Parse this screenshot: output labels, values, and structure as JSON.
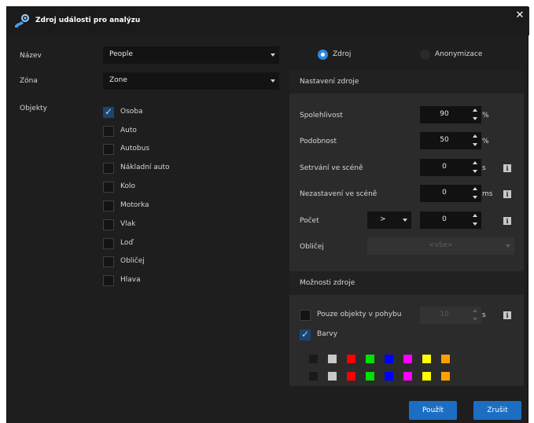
{
  "dialog": {
    "title": "Zdroj události pro analýzu",
    "close_label": "✕",
    "title_icon": "camera-gear-icon"
  },
  "left": {
    "name_label": "Název",
    "name_value": "People",
    "zone_label": "Zóna",
    "zone_value": "Zone",
    "objects_label": "Objekty",
    "objects": [
      {
        "label": "Osoba",
        "checked": true
      },
      {
        "label": "Auto",
        "checked": false
      },
      {
        "label": "Autobus",
        "checked": false
      },
      {
        "label": "Nákladní auto",
        "checked": false
      },
      {
        "label": "Kolo",
        "checked": false
      },
      {
        "label": "Motorka",
        "checked": false
      },
      {
        "label": "Vlak",
        "checked": false
      },
      {
        "label": "Loď",
        "checked": false
      },
      {
        "label": "Obličej",
        "checked": false
      },
      {
        "label": "Hlava",
        "checked": false
      }
    ]
  },
  "mode": {
    "source_label": "Zdroj",
    "anonymization_label": "Anonymizace",
    "selected": "source"
  },
  "source_settings": {
    "header": "Nastavení zdroje",
    "reliability": {
      "label": "Spolehlivost",
      "value": "90",
      "unit": "%"
    },
    "similarity": {
      "label": "Podobnost",
      "value": "50",
      "unit": "%"
    },
    "dwell": {
      "label": "Setrvání ve scéně",
      "value": "0",
      "unit": "s"
    },
    "absence": {
      "label": "Nezastavení ve scéně",
      "value": "0",
      "unit": "ms"
    },
    "count": {
      "label": "Počet",
      "operator": ">",
      "value": "0"
    },
    "face": {
      "label": "Obličej",
      "value": "<vše>"
    }
  },
  "source_options": {
    "header": "Možnosti zdroje",
    "moving_only": {
      "label": "Pouze objekty v pohybu",
      "checked": false,
      "value": "10",
      "unit": "s"
    },
    "colors": {
      "label": "Barvy",
      "checked": true
    },
    "palette_row1": [
      "#1a1a1a",
      "#c8c8c8",
      "#ff0000",
      "#00e000",
      "#0000ff",
      "#ff00ff",
      "#ffff00",
      "#ffa000"
    ],
    "palette_row2": [
      "#1a1a1a",
      "#c8c8c8",
      "#ff0000",
      "#00e000",
      "#0000ff",
      "#ff00ff",
      "#ffff00",
      "#ffa000"
    ]
  },
  "buttons": {
    "apply": "Použít",
    "cancel": "Zrušit"
  },
  "colors": {
    "accent": "#1c6ec3",
    "background": "#1e1e1e",
    "panel": "#2b2b2b"
  }
}
